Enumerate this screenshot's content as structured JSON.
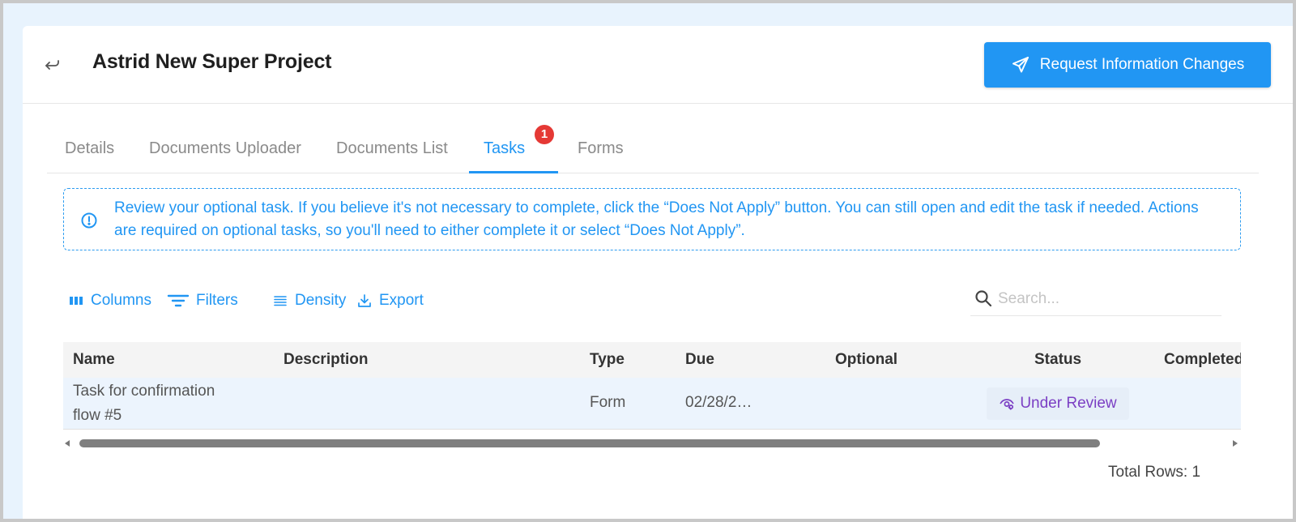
{
  "header": {
    "title": "Astrid New Super Project",
    "request_button_label": "Request Information Changes"
  },
  "tabs": [
    {
      "label": "Details"
    },
    {
      "label": "Documents Uploader"
    },
    {
      "label": "Documents List"
    },
    {
      "label": "Tasks",
      "active": true,
      "badge": "1"
    },
    {
      "label": "Forms"
    }
  ],
  "info": {
    "text": "Review your optional task. If you believe it's not necessary to complete, click the “Does Not Apply” button. You can still open and edit the task if needed. Actions are required on optional tasks, so you'll need to either complete it or select “Does Not Apply”."
  },
  "toolbar": {
    "columns_label": "Columns",
    "filters_label": "Filters",
    "density_label": "Density",
    "export_label": "Export"
  },
  "search": {
    "placeholder": "Search..."
  },
  "table": {
    "columns": [
      "Name",
      "Description",
      "Type",
      "Due",
      "Optional",
      "Status",
      "Completed"
    ],
    "rows": [
      {
        "name_line1": "Task for confirmation",
        "name_line2": "flow #5",
        "description": "",
        "type": "Form",
        "due": "02/28/2…",
        "optional": "",
        "status": "Under Review"
      }
    ],
    "total_rows": "Total Rows: 1"
  },
  "colors": {
    "accent": "#2196f3",
    "badge": "#e53935",
    "status": "#7b3fc4"
  }
}
